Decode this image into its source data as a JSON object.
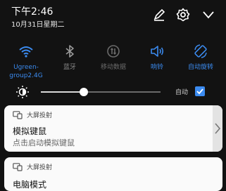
{
  "status": {
    "time": "下午2:46",
    "date": "10月31日星期二"
  },
  "header_icons": [
    "edit-icon",
    "settings-icon",
    "collapse-chevron-icon"
  ],
  "tiles": [
    {
      "label_line1": "Ugreen-",
      "label_line2": "group2.4G",
      "icon": "wifi-icon",
      "state": "on"
    },
    {
      "label": "蓝牙",
      "icon": "bluetooth-icon",
      "state": "off"
    },
    {
      "label": "移动数据",
      "icon": "mobile-data-icon",
      "state": "disabled"
    },
    {
      "label": "响铃",
      "icon": "ring-volume-icon",
      "state": "on"
    },
    {
      "label": "自动旋转",
      "icon": "auto-rotate-icon",
      "state": "on"
    }
  ],
  "brightness": {
    "level": 0.36,
    "auto_label": "自动",
    "auto_checked": true
  },
  "notifications": [
    {
      "app": "大屏投射",
      "title": "模拟键鼠",
      "body": "点击启动模拟键鼠"
    },
    {
      "app": "大屏投射",
      "title": "电脑模式"
    }
  ],
  "colors": {
    "accent": "#3b8bf0",
    "panel_bg": "#121212",
    "card_bg": "#fafafa"
  }
}
